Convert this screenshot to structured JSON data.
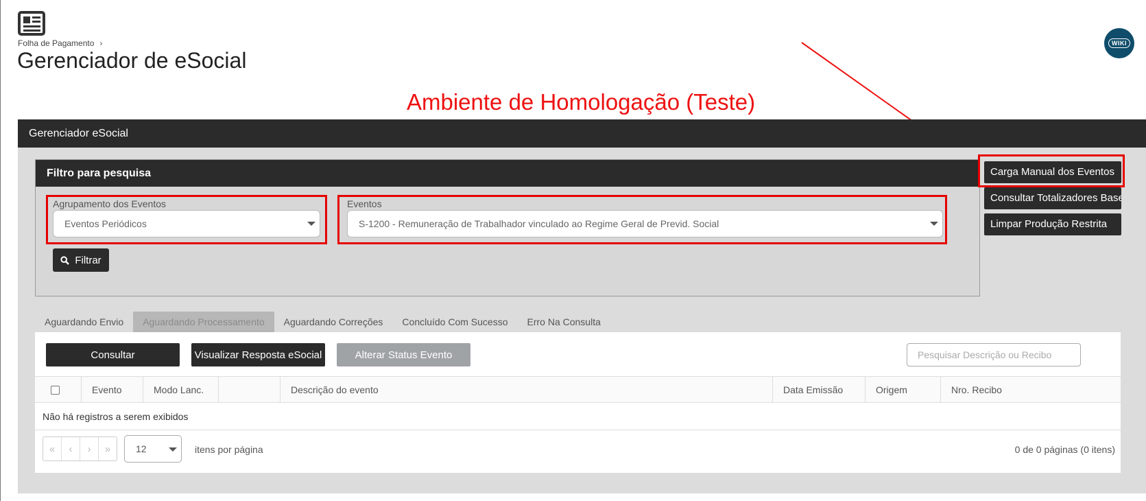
{
  "breadcrumb": {
    "item": "Folha de Pagamento",
    "separator": "›"
  },
  "page": {
    "title": "Gerenciador de eSocial"
  },
  "wiki": {
    "label": "WIKI"
  },
  "annotation": {
    "text": "Ambiente de Homologação (Teste)",
    "color": "#ee1111"
  },
  "panel": {
    "title": "Gerenciador eSocial"
  },
  "filter": {
    "title": "Filtro para pesquisa",
    "group_label": "Agrupamento dos Eventos",
    "group_value": "Eventos Periódicos",
    "events_label": "Eventos",
    "events_value": "S-1200 - Remuneração de Trabalhador vinculado ao Regime Geral de Previd. Social",
    "filter_button": "Filtrar"
  },
  "side_buttons": {
    "manual_load": "Carga Manual dos Eventos",
    "totalizers": "Consultar Totalizadores Base",
    "clear_restricted": "Limpar Produção Restrita"
  },
  "tabs": [
    {
      "label": "Aguardando Envio"
    },
    {
      "label": "Aguardando Processamento"
    },
    {
      "label": "Aguardando Correções"
    },
    {
      "label": "Concluído Com Sucesso"
    },
    {
      "label": "Erro Na Consulta"
    }
  ],
  "actions": {
    "consult": "Consultar",
    "view_response": "Visualizar Resposta eSocial",
    "change_status": "Alterar Status Evento"
  },
  "search": {
    "placeholder": "Pesquisar Descrição ou Recibo"
  },
  "grid": {
    "columns": [
      "Evento",
      "Modo Lanc.",
      "",
      "Descrição do evento",
      "Data Emissão",
      "Origem",
      "Nro. Recibo"
    ],
    "empty_message": "Não há registros a serem exibidos"
  },
  "pager": {
    "page_size": "12",
    "per_page_label": "itens por página",
    "info": "0 de 0 páginas (0 itens)"
  },
  "colors": {
    "dark": "#2b2b2b",
    "accent_red": "#e60000",
    "wiki_bg": "#0f4d6b",
    "disabled_btn": "#9fa3a6"
  }
}
